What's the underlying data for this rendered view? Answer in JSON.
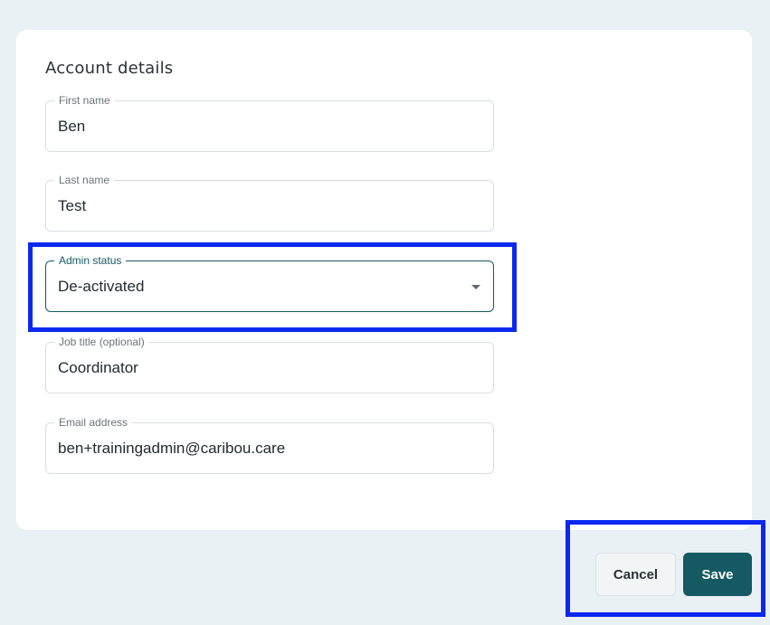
{
  "card": {
    "title": "Account details"
  },
  "fields": {
    "first_name": {
      "label": "First name",
      "value": "Ben"
    },
    "last_name": {
      "label": "Last name",
      "value": "Test"
    },
    "admin_status": {
      "label": "Admin status",
      "value": "De-activated",
      "icon": "chevron-down-icon"
    },
    "job_title": {
      "label": "Job title (optional)",
      "value": "Coordinator"
    },
    "email": {
      "label": "Email address",
      "value": "ben+trainingadmin@caribou.care"
    }
  },
  "actions": {
    "cancel_label": "Cancel",
    "save_label": "Save"
  },
  "colors": {
    "page_background": "#e9f1f4",
    "accent": "#155a62",
    "highlight": "#0a28f0"
  }
}
